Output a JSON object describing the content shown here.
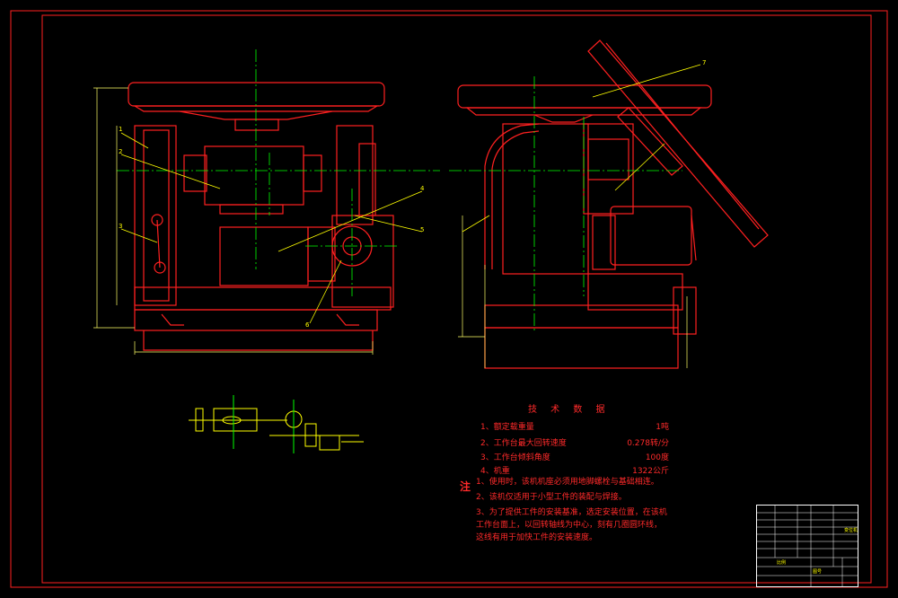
{
  "drawing": {
    "colors": {
      "background": "#000000",
      "outline": "#ff2020",
      "centerline": "#00ff00",
      "leader": "#ffff00",
      "dimension": "#ffff66",
      "border": "#ff2020"
    },
    "callouts": [
      "1",
      "2",
      "3",
      "4",
      "5",
      "6",
      "7"
    ]
  },
  "tech_data": {
    "title": "技 术 数 据",
    "specs": [
      {
        "label": "1、额定载重量",
        "value": "1吨"
      },
      {
        "label": "2、工作台最大回转速度",
        "value": "0.278转/分"
      },
      {
        "label": "3、工作台倾斜角度",
        "value": "100度"
      },
      {
        "label": "4、机重",
        "value": "1322公斤"
      }
    ]
  },
  "notes": {
    "mark": "注",
    "items": [
      "1、使用时，该机机座必须用地脚螺栓与基础相连。",
      "2、该机仅适用于小型工件的装配与焊接。",
      "3、为了提供工件的安装基准，选定安装位置，在该机工作台面上，以回转轴线为中心，刻有几圈圆环线，这线有用于加快工件的安装速度。"
    ]
  },
  "title_block": {
    "drawing_name": "变位机",
    "label_a": "比例",
    "label_b": "图号"
  }
}
